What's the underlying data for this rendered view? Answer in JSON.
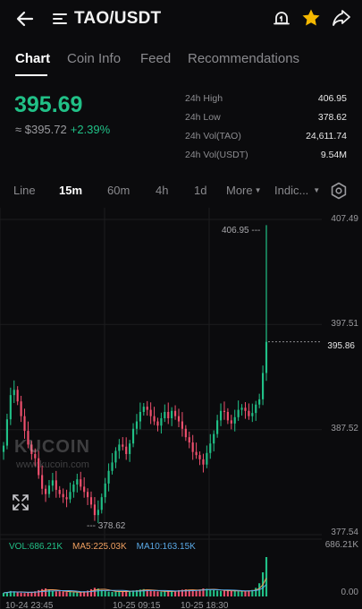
{
  "header": {
    "title": "TAO/USDT",
    "back_icon": "arrow-left-icon",
    "menu_icon": "list-icon",
    "alert_icon": "price-alert-icon",
    "favorite_icon": "star-icon",
    "share_icon": "share-icon",
    "favorite_color": "#f5b800"
  },
  "tabs": [
    {
      "label": "Chart",
      "active": true
    },
    {
      "label": "Coin Info",
      "active": false
    },
    {
      "label": "Feed",
      "active": false
    },
    {
      "label": "Recommendations",
      "active": false
    }
  ],
  "price": {
    "last": "395.69",
    "fiat": "≈ $395.72",
    "change": "+2.39%",
    "up_color": "#21c087",
    "down_color": "#f0506e"
  },
  "stats": [
    {
      "label": "24h High",
      "value": "406.95"
    },
    {
      "label": "24h Low",
      "value": "378.62"
    },
    {
      "label": "24h Vol(TAO)",
      "value": "24,611.74"
    },
    {
      "label": "24h Vol(USDT)",
      "value": "9.54M"
    }
  ],
  "toolbar": {
    "intervals": [
      "Line",
      "15m",
      "60m",
      "4h",
      "1d"
    ],
    "active_interval": "15m",
    "more_label": "More",
    "indicators_label": "Indic...",
    "settings_icon": "settings-icon"
  },
  "chart_data": {
    "type": "candlestick",
    "interval": "15m",
    "y_ticks": [
      "407.49",
      "397.51",
      "387.52",
      "377.54"
    ],
    "ylim": [
      377.54,
      407.49
    ],
    "current_price_label": "395.86",
    "current_price": 395.86,
    "high_marker": "406.95",
    "low_marker": "378.62",
    "x_tick_labels": [
      "10-24 23:45",
      "10-25 09:15",
      "10-25 18:30"
    ],
    "closes": [
      386,
      388.5,
      390.8,
      391.3,
      390.2,
      388.8,
      387.4,
      386.1,
      385.2,
      384.8,
      383.2,
      381.9,
      381.4,
      382.2,
      382.7,
      381.8,
      381.4,
      381.1,
      380.9,
      381.6,
      382.3,
      382.8,
      382.1,
      381.6,
      381.1,
      380.4,
      379.4,
      379.9,
      381.1,
      382.4,
      383.6,
      384.4,
      385.5,
      386.1,
      385.9,
      385.2,
      386.2,
      387.6,
      388.3,
      389.2,
      389.7,
      389.4,
      388.8,
      388.3,
      387.9,
      388.6,
      389.2,
      388.6,
      389.3,
      388.8,
      388.3,
      387.6,
      386.8,
      386.3,
      385.4,
      385.1,
      384.7,
      384.2,
      385.3,
      386.2,
      387.1,
      388.4,
      389.3,
      389.2,
      388.4,
      388.1,
      388.7,
      389.4,
      389.6,
      389.3,
      388.8,
      389.1,
      389.9,
      390.4,
      392.9,
      395.86
    ],
    "watermark": {
      "logo": "KUCOIN",
      "url": "www.kucoin.com"
    },
    "volume": {
      "legend": {
        "vol": "VOL:686.21K",
        "ma5": "MA5:225.03K",
        "ma10": "MA10:163.15K"
      },
      "max_label": "686.21K",
      "min_label": "0.00",
      "colors": {
        "vol": "#21c087",
        "ma5": "#f0a060",
        "ma10": "#5aa9e6"
      },
      "values": [
        62,
        78,
        95,
        88,
        70,
        65,
        60,
        72,
        80,
        90,
        110,
        128,
        140,
        115,
        95,
        88,
        92,
        84,
        76,
        80,
        70,
        68,
        74,
        90,
        102,
        126,
        150,
        138,
        112,
        96,
        84,
        78,
        82,
        88,
        92,
        85,
        90,
        104,
        110,
        120,
        128,
        110,
        98,
        94,
        88,
        82,
        90,
        86,
        92,
        96,
        110,
        118,
        124,
        116,
        104,
        98,
        122,
        140,
        134,
        120,
        110,
        102,
        96,
        104,
        98,
        94,
        100,
        92,
        88,
        96,
        104,
        114,
        150,
        230,
        420,
        686
      ]
    }
  }
}
